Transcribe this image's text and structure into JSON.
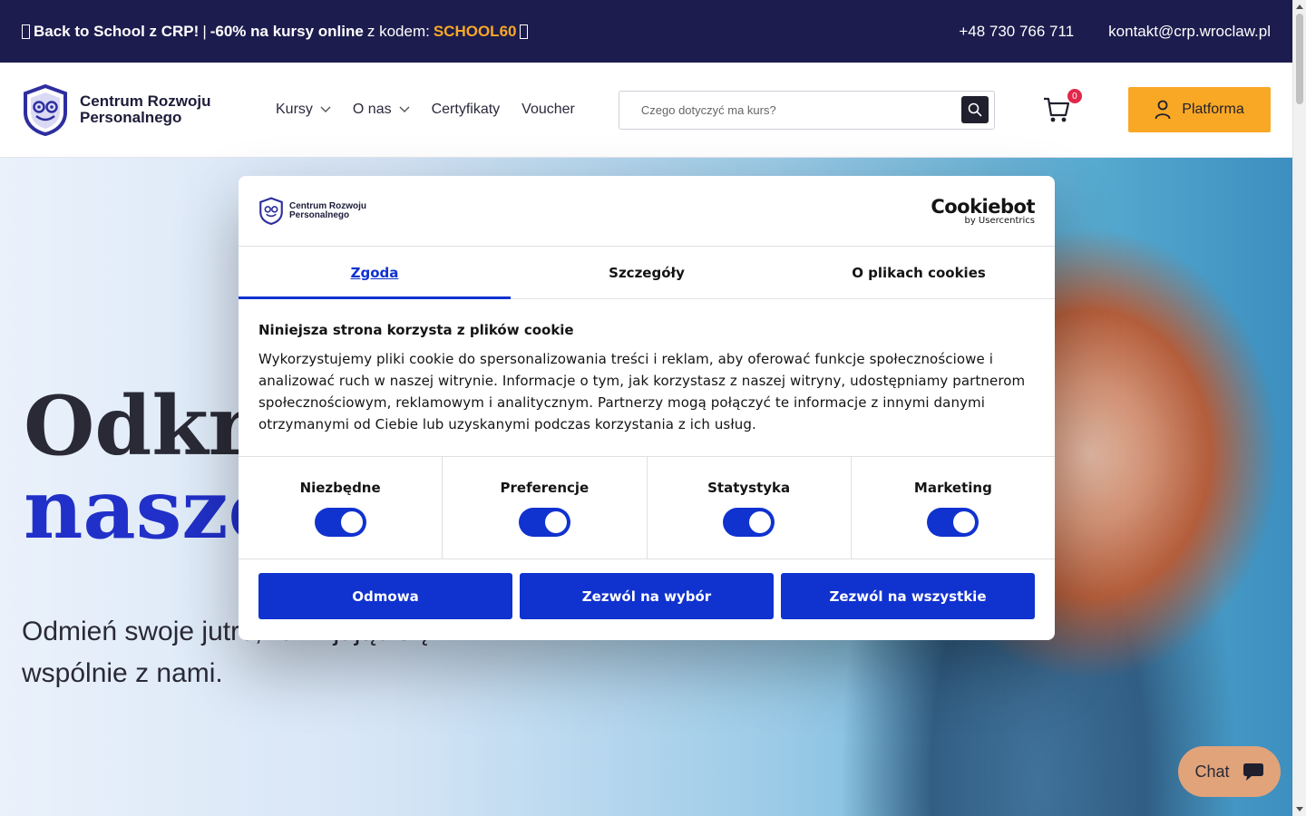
{
  "promo": {
    "part1": "Back to School z CRP!",
    "separator": "|",
    "part2": "-60% na kursy online",
    "part3": "z kodem:",
    "code": "SCHOOL60"
  },
  "contact": {
    "phone": "+48 730 766 711",
    "email": "kontakt@crp.wroclaw.pl"
  },
  "logo": {
    "line1": "Centrum Rozwoju",
    "line2": "Personalnego"
  },
  "nav": {
    "items": [
      {
        "label": "Kursy"
      },
      {
        "label": "O nas"
      },
      {
        "label": "Certyfikaty"
      },
      {
        "label": "Voucher"
      }
    ]
  },
  "search": {
    "placeholder": "Czego dotyczyć ma kurs?"
  },
  "cart": {
    "count": "0"
  },
  "platform_button": "Platforma",
  "hero": {
    "title_line1": "Odkryj",
    "title_line2": "nasze",
    "subtitle": "Odmień swoje jutro, rozwijając się wspólnie z nami."
  },
  "chat": {
    "label": "Chat"
  },
  "cookie": {
    "logo_line1": "Centrum Rozwoju",
    "logo_line2": "Personalnego",
    "brand": "Cookiebot",
    "brand_by": "by Usercentrics",
    "tabs": [
      {
        "label": "Zgoda"
      },
      {
        "label": "Szczegóły"
      },
      {
        "label": "O plikach cookies"
      }
    ],
    "heading": "Niniejsza strona korzysta z plików cookie",
    "text": "Wykorzystujemy pliki cookie do spersonalizowania treści i reklam, aby oferować funkcje społecznościowe i analizować ruch w naszej witrynie. Informacje o tym, jak korzystasz z naszej witryny, udostępniamy partnerom społecznościowym, reklamowym i analitycznym. Partnerzy mogą połączyć te informacje z innymi danymi otrzymanymi od Ciebie lub uzyskanymi podczas korzystania z ich usług.",
    "categories": [
      {
        "label": "Niezbędne",
        "enabled": true
      },
      {
        "label": "Preferencje",
        "enabled": true
      },
      {
        "label": "Statystyka",
        "enabled": true
      },
      {
        "label": "Marketing",
        "enabled": true
      }
    ],
    "buttons": {
      "deny": "Odmowa",
      "allow_selection": "Zezwól na wybór",
      "allow_all": "Zezwól na wszystkie"
    }
  },
  "colors": {
    "navy": "#1c1c4e",
    "accent_orange": "#f9a825",
    "cookie_blue": "#1032cf",
    "hero_accent": "#2130c8"
  }
}
